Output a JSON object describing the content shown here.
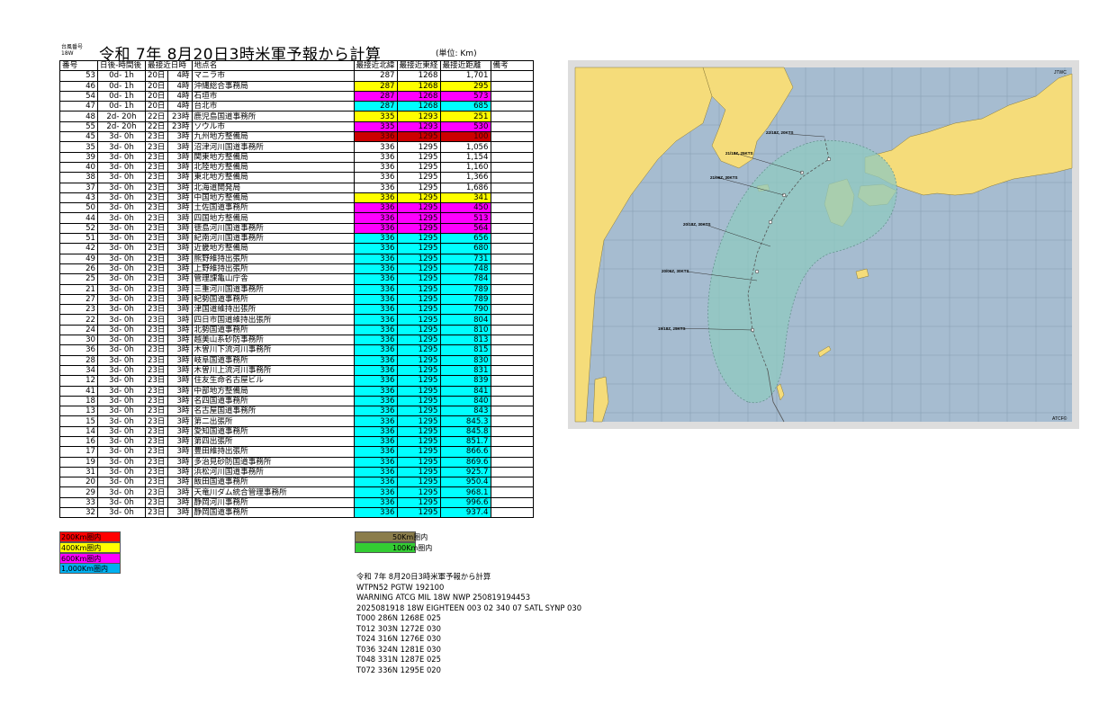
{
  "header": {
    "small_label_1": "台風番号",
    "small_label_2": "18W",
    "title": "令和 7年 8月20日3時米軍予報から計算",
    "unit": "(単位: Km)"
  },
  "table": {
    "columns": [
      "番号",
      "日後-時間後",
      "最接近日時",
      "地点名",
      "最接近北緯",
      "最接近東経",
      "最接近距離",
      "備考"
    ],
    "rows": [
      {
        "no": "53",
        "after": "0d- 1h",
        "day": "20日",
        "hour": "4時",
        "name": "マニラ市",
        "lat": "287",
        "lon": "1268",
        "dist": "1,701",
        "color": "#ffffff"
      },
      {
        "no": "46",
        "after": "0d- 1h",
        "day": "20日",
        "hour": "4時",
        "name": "沖縄総合事務局",
        "lat": "287",
        "lon": "1268",
        "dist": "295",
        "color": "#ffff00"
      },
      {
        "no": "54",
        "after": "0d- 1h",
        "day": "20日",
        "hour": "4時",
        "name": "石垣市",
        "lat": "287",
        "lon": "1268",
        "dist": "573",
        "color": "#ff00ff"
      },
      {
        "no": "47",
        "after": "0d- 1h",
        "day": "20日",
        "hour": "4時",
        "name": "台北市",
        "lat": "287",
        "lon": "1268",
        "dist": "685",
        "color": "#00ffff"
      },
      {
        "no": "48",
        "after": "2d- 20h",
        "day": "22日",
        "hour": "23時",
        "name": "鹿児島国道事務所",
        "lat": "335",
        "lon": "1293",
        "dist": "251",
        "color": "#ffff00"
      },
      {
        "no": "55",
        "after": "2d- 20h",
        "day": "22日",
        "hour": "23時",
        "name": "ソウル市",
        "lat": "335",
        "lon": "1293",
        "dist": "530",
        "color": "#ff00ff"
      },
      {
        "no": "45",
        "after": "3d- 0h",
        "day": "23日",
        "hour": "3時",
        "name": "九州地方整備局",
        "lat": "336",
        "lon": "1295",
        "dist": "100",
        "color": "#cc0000"
      },
      {
        "no": "35",
        "after": "3d- 0h",
        "day": "23日",
        "hour": "3時",
        "name": "沼津河川国道事務所",
        "lat": "336",
        "lon": "1295",
        "dist": "1,056",
        "color": "#ffffff"
      },
      {
        "no": "39",
        "after": "3d- 0h",
        "day": "23日",
        "hour": "3時",
        "name": "関東地方整備局",
        "lat": "336",
        "lon": "1295",
        "dist": "1,154",
        "color": "#ffffff"
      },
      {
        "no": "40",
        "after": "3d- 0h",
        "day": "23日",
        "hour": "3時",
        "name": "北陸地方整備局",
        "lat": "336",
        "lon": "1295",
        "dist": "1,160",
        "color": "#ffffff"
      },
      {
        "no": "38",
        "after": "3d- 0h",
        "day": "23日",
        "hour": "3時",
        "name": "東北地方整備局",
        "lat": "336",
        "lon": "1295",
        "dist": "1,366",
        "color": "#ffffff"
      },
      {
        "no": "37",
        "after": "3d- 0h",
        "day": "23日",
        "hour": "3時",
        "name": "北海道開発局",
        "lat": "336",
        "lon": "1295",
        "dist": "1,686",
        "color": "#ffffff"
      },
      {
        "no": "43",
        "after": "3d- 0h",
        "day": "23日",
        "hour": "3時",
        "name": "中国地方整備局",
        "lat": "336",
        "lon": "1295",
        "dist": "341",
        "color": "#ffff00"
      },
      {
        "no": "50",
        "after": "3d- 0h",
        "day": "23日",
        "hour": "3時",
        "name": "土佐国道事務所",
        "lat": "336",
        "lon": "1295",
        "dist": "450",
        "color": "#ff00ff"
      },
      {
        "no": "44",
        "after": "3d- 0h",
        "day": "23日",
        "hour": "3時",
        "name": "四国地方整備局",
        "lat": "336",
        "lon": "1295",
        "dist": "513",
        "color": "#ff00ff"
      },
      {
        "no": "52",
        "after": "3d- 0h",
        "day": "23日",
        "hour": "3時",
        "name": "徳島河川国道事務所",
        "lat": "336",
        "lon": "1295",
        "dist": "564",
        "color": "#ff00ff"
      },
      {
        "no": "51",
        "after": "3d- 0h",
        "day": "23日",
        "hour": "3時",
        "name": "紀南河川国道事務所",
        "lat": "336",
        "lon": "1295",
        "dist": "656",
        "color": "#00ffff"
      },
      {
        "no": "42",
        "after": "3d- 0h",
        "day": "23日",
        "hour": "3時",
        "name": "近畿地方整備局",
        "lat": "336",
        "lon": "1295",
        "dist": "680",
        "color": "#00ffff"
      },
      {
        "no": "49",
        "after": "3d- 0h",
        "day": "23日",
        "hour": "3時",
        "name": "熊野維持出張所",
        "lat": "336",
        "lon": "1295",
        "dist": "731",
        "color": "#00ffff"
      },
      {
        "no": "26",
        "after": "3d- 0h",
        "day": "23日",
        "hour": "3時",
        "name": "上野維持出張所",
        "lat": "336",
        "lon": "1295",
        "dist": "748",
        "color": "#00ffff"
      },
      {
        "no": "25",
        "after": "3d- 0h",
        "day": "23日",
        "hour": "3時",
        "name": "管理課亀山庁舎",
        "lat": "336",
        "lon": "1295",
        "dist": "784",
        "color": "#00ffff"
      },
      {
        "no": "21",
        "after": "3d- 0h",
        "day": "23日",
        "hour": "3時",
        "name": "三重河川国道事務所",
        "lat": "336",
        "lon": "1295",
        "dist": "789",
        "color": "#00ffff"
      },
      {
        "no": "27",
        "after": "3d- 0h",
        "day": "23日",
        "hour": "3時",
        "name": "紀勢国道事務所",
        "lat": "336",
        "lon": "1295",
        "dist": "789",
        "color": "#00ffff"
      },
      {
        "no": "23",
        "after": "3d- 0h",
        "day": "23日",
        "hour": "3時",
        "name": "津国道維持出張所",
        "lat": "336",
        "lon": "1295",
        "dist": "790",
        "color": "#00ffff"
      },
      {
        "no": "22",
        "after": "3d- 0h",
        "day": "23日",
        "hour": "3時",
        "name": "四日市国道維持出張所",
        "lat": "336",
        "lon": "1295",
        "dist": "804",
        "color": "#00ffff"
      },
      {
        "no": "24",
        "after": "3d- 0h",
        "day": "23日",
        "hour": "3時",
        "name": "北勢国道事務所",
        "lat": "336",
        "lon": "1295",
        "dist": "810",
        "color": "#00ffff"
      },
      {
        "no": "30",
        "after": "3d- 0h",
        "day": "23日",
        "hour": "3時",
        "name": "越美山系砂防事務所",
        "lat": "336",
        "lon": "1295",
        "dist": "813",
        "color": "#00ffff"
      },
      {
        "no": "36",
        "after": "3d- 0h",
        "day": "23日",
        "hour": "3時",
        "name": "木曽川下流河川事務所",
        "lat": "336",
        "lon": "1295",
        "dist": "815",
        "color": "#00ffff"
      },
      {
        "no": "28",
        "after": "3d- 0h",
        "day": "23日",
        "hour": "3時",
        "name": "岐阜国道事務所",
        "lat": "336",
        "lon": "1295",
        "dist": "830",
        "color": "#00ffff"
      },
      {
        "no": "34",
        "after": "3d- 0h",
        "day": "23日",
        "hour": "3時",
        "name": "木曽川上流河川事務所",
        "lat": "336",
        "lon": "1295",
        "dist": "831",
        "color": "#00ffff"
      },
      {
        "no": "12",
        "after": "3d- 0h",
        "day": "23日",
        "hour": "3時",
        "name": "住友生命名古屋ビル",
        "lat": "336",
        "lon": "1295",
        "dist": "839",
        "color": "#00ffff"
      },
      {
        "no": "41",
        "after": "3d- 0h",
        "day": "23日",
        "hour": "3時",
        "name": "中部地方整備局",
        "lat": "336",
        "lon": "1295",
        "dist": "841",
        "color": "#00ffff"
      },
      {
        "no": "18",
        "after": "3d- 0h",
        "day": "23日",
        "hour": "3時",
        "name": "名四国道事務所",
        "lat": "336",
        "lon": "1295",
        "dist": "840",
        "color": "#00ffff"
      },
      {
        "no": "13",
        "after": "3d- 0h",
        "day": "23日",
        "hour": "3時",
        "name": "名古屋国道事務所",
        "lat": "336",
        "lon": "1295",
        "dist": "843",
        "color": "#00ffff"
      },
      {
        "no": "15",
        "after": "3d- 0h",
        "day": "23日",
        "hour": "3時",
        "name": "第二出張所",
        "lat": "336",
        "lon": "1295",
        "dist": "845.3",
        "color": "#00ffff"
      },
      {
        "no": "14",
        "after": "3d- 0h",
        "day": "23日",
        "hour": "3時",
        "name": "愛知国道事務所",
        "lat": "336",
        "lon": "1295",
        "dist": "845.8",
        "color": "#00ffff"
      },
      {
        "no": "16",
        "after": "3d- 0h",
        "day": "23日",
        "hour": "3時",
        "name": "第四出張所",
        "lat": "336",
        "lon": "1295",
        "dist": "851.7",
        "color": "#00ffff"
      },
      {
        "no": "17",
        "after": "3d- 0h",
        "day": "23日",
        "hour": "3時",
        "name": "豊田維持出張所",
        "lat": "336",
        "lon": "1295",
        "dist": "866.6",
        "color": "#00ffff"
      },
      {
        "no": "19",
        "after": "3d- 0h",
        "day": "23日",
        "hour": "3時",
        "name": "多治見砂防国道事務所",
        "lat": "336",
        "lon": "1295",
        "dist": "869.6",
        "color": "#00ffff"
      },
      {
        "no": "31",
        "after": "3d- 0h",
        "day": "23日",
        "hour": "3時",
        "name": "浜松河川国道事務所",
        "lat": "336",
        "lon": "1295",
        "dist": "925.7",
        "color": "#00ffff"
      },
      {
        "no": "20",
        "after": "3d- 0h",
        "day": "23日",
        "hour": "3時",
        "name": "飯田国道事務所",
        "lat": "336",
        "lon": "1295",
        "dist": "950.4",
        "color": "#00ffff"
      },
      {
        "no": "29",
        "after": "3d- 0h",
        "day": "23日",
        "hour": "3時",
        "name": "天竜川ダム統合管理事務所",
        "lat": "336",
        "lon": "1295",
        "dist": "968.1",
        "color": "#00ffff"
      },
      {
        "no": "33",
        "after": "3d- 0h",
        "day": "23日",
        "hour": "3時",
        "name": "静岡河川事務所",
        "lat": "336",
        "lon": "1295",
        "dist": "996.6",
        "color": "#00ffff"
      },
      {
        "no": "32",
        "after": "3d- 0h",
        "day": "23日",
        "hour": "3時",
        "name": "静岡国道事務所",
        "lat": "336",
        "lon": "1295",
        "dist": "937.4",
        "color": "#00ffff"
      }
    ]
  },
  "legend": [
    {
      "label": "200Km圏内",
      "color": "#ff0000"
    },
    {
      "label": "400Km圏内",
      "color": "#ffff00"
    },
    {
      "label": "600Km圏内",
      "color": "#ff00ff"
    },
    {
      "label": "1,000Km圏内",
      "color": "#00b0f0"
    },
    {
      "label": "50Km圏内",
      "color": "#8b7d4b"
    },
    {
      "label": "100Km圏内",
      "color": "#33cc33"
    }
  ],
  "bulletin": [
    "令和 7年 8月20日3時米軍予報から計算",
    "WTPN52 PGTW 192100",
    "WARNING    ATCG MIL 18W NWP 250819194453",
    "2025081918 18W EIGHTEEN    003   02 340 07 SATL SYNP 030",
    "T000 286N 1268E 025",
    "T012 303N 1272E 030",
    "T024 316N 1276E 030",
    "T036 324N 1281E 030",
    "T048 331N 1287E 025",
    "T072 336N 1295E 020"
  ],
  "map": {
    "corner_top": "JTWC",
    "corner_bottom": "ATCF©",
    "labels": [
      {
        "id": "l1",
        "text": "22/18Z, 20KTS"
      },
      {
        "id": "l2",
        "text": "21/18Z, 25KTS"
      },
      {
        "id": "l3",
        "text": "21/06Z, 30KTS"
      },
      {
        "id": "l4",
        "text": "20/18Z, 30KTS"
      },
      {
        "id": "l5",
        "text": "20/06Z, 30KTS"
      },
      {
        "id": "l6",
        "text": "19/18Z, 25KTS"
      }
    ],
    "colors": {
      "ocean": "#a6bcd0",
      "land": "#f5dc7a",
      "cone": "#8fc9c0"
    }
  }
}
